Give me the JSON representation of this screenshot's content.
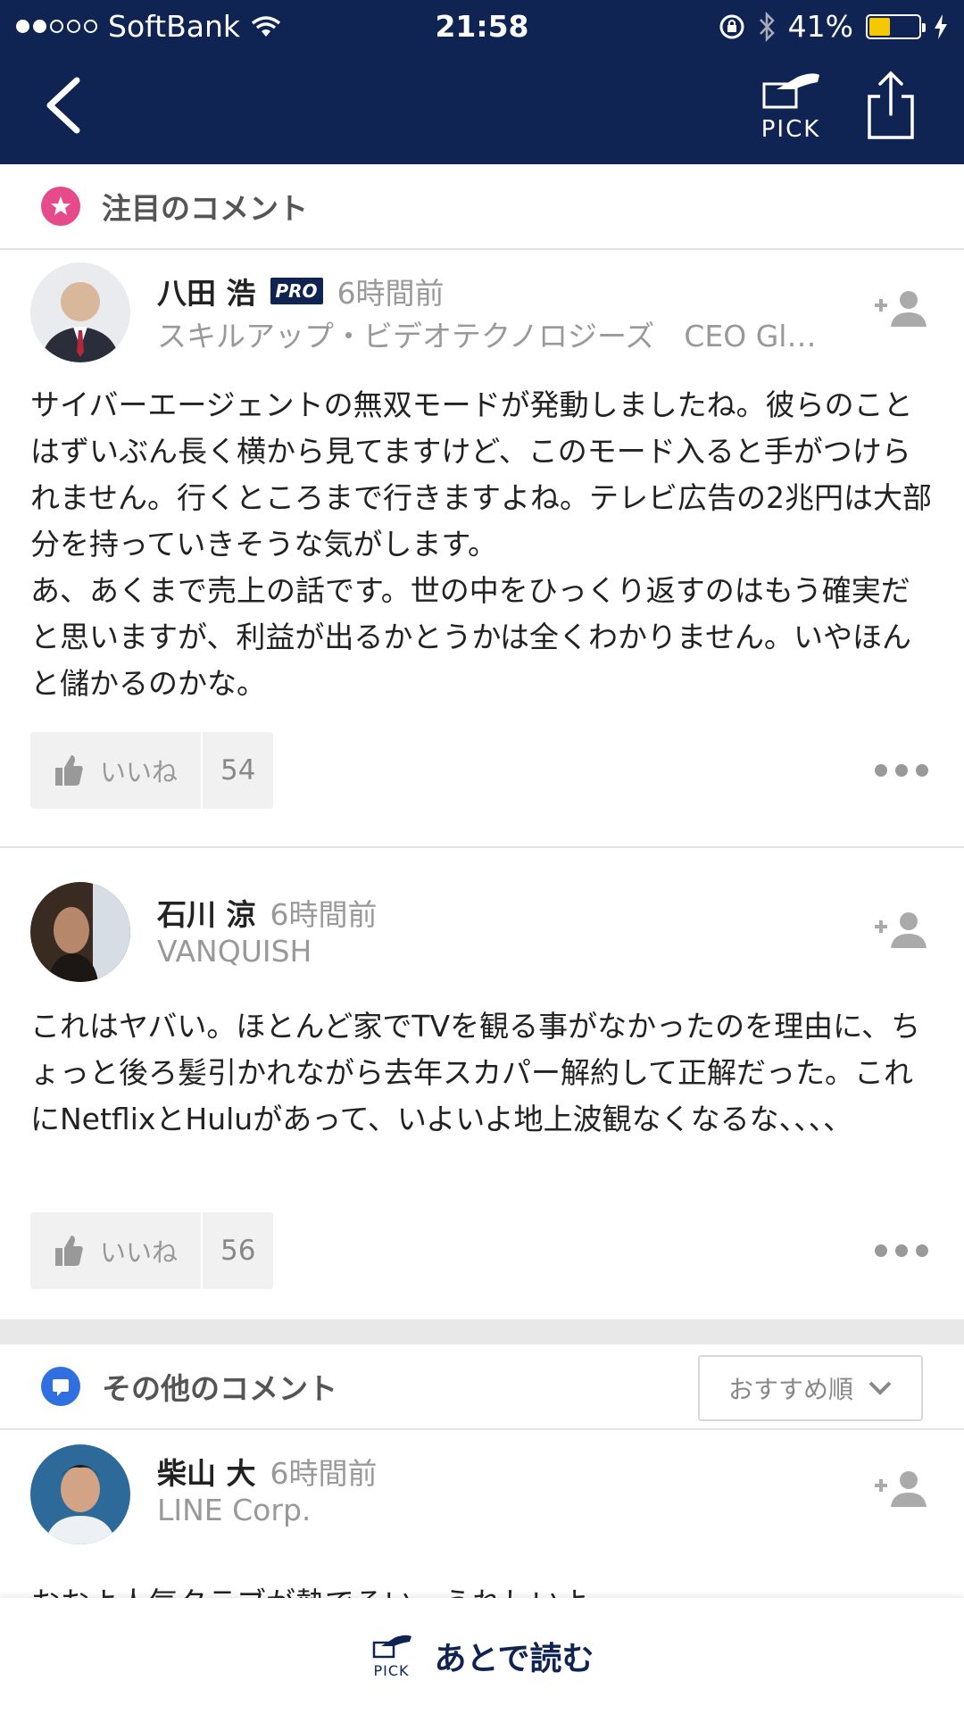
{
  "status_bar": {
    "carrier": "SoftBank",
    "time": "21:58",
    "battery": "41%"
  },
  "navbar": {
    "pick_label": "PICK"
  },
  "featured_section": {
    "title": "注目のコメント"
  },
  "comments": [
    {
      "name": "八田 浩",
      "badge": "PRO",
      "time_ago": "6時間前",
      "org": "スキルアップ・ビデオテクノロジーズ　CEO Gl…",
      "body": "サイバーエージェントの無双モードが発動しましたね。彼らのことはずいぶん長く横から見てますけど、このモード入ると手がつけられません。行くところまで行きますよね。テレビ広告の2兆円は大部分を持っていきそうな気がします。\nあ、あくまで売上の話です。世の中をひっくり返すのはもう確実だと思いますが、利益が出るかとうかは全くわかりません。いやほんと儲かるのかな。",
      "like_label": "いいね",
      "like_count": "54"
    },
    {
      "name": "石川 涼",
      "time_ago": "6時間前",
      "org": "VANQUISH",
      "body": "これはヤバい。ほとんど家でTVを観る事がなかったのを理由に、ちょっと後ろ髪引かれながら去年スカパー解約して正解だった。これにNetflixとHuluがあって、いよいよ地上波観なくなるな、、、、",
      "like_label": "いいね",
      "like_count": "56"
    },
    {
      "name": "柴山 大",
      "time_ago": "6時間前",
      "org": "LINE Corp.",
      "body": "おおよ人気タラブが熱でるい、うれしいよ"
    }
  ],
  "other_section": {
    "title": "その他のコメント",
    "sort_label": "おすすめ順"
  },
  "bottom_bar": {
    "pick_label": "PICK",
    "read_later": "あとで読む"
  },
  "colors": {
    "navy": "#0f2452",
    "featured_badge": "#e64a8a",
    "other_badge": "#2f6fe0"
  }
}
